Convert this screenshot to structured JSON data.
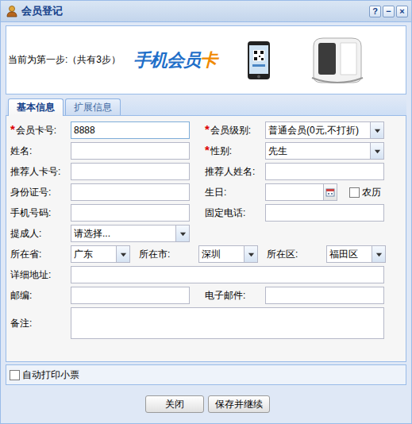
{
  "window": {
    "title": "会员登记",
    "controls": [
      "?",
      "−",
      "×"
    ]
  },
  "banner": {
    "step": "当前为第一步:（共有3步）",
    "logo": {
      "main": "手机会员",
      "accent": "卡"
    }
  },
  "tabs": [
    {
      "label": "基本信息",
      "selected": true
    },
    {
      "label": "扩展信息",
      "selected": false
    }
  ],
  "form": {
    "rows": [
      {
        "kind": "pair",
        "cells": [
          {
            "label": "会员卡号:",
            "required": true,
            "control": "text",
            "value": "8888",
            "focused": true
          },
          {
            "label": "会员级别:",
            "required": true,
            "control": "select",
            "value": "普通会员(0元,不打折)",
            "focused": false
          }
        ]
      },
      {
        "kind": "pair",
        "cells": [
          {
            "label": "姓名:",
            "required": false,
            "control": "text",
            "value": "",
            "focused": false
          },
          {
            "label": "性别:",
            "required": true,
            "control": "select",
            "value": "先生",
            "focused": false
          }
        ]
      },
      {
        "kind": "pair",
        "cells": [
          {
            "label": "推荐人卡号:",
            "required": false,
            "control": "text",
            "value": "",
            "focused": false
          },
          {
            "label": "推荐人姓名:",
            "required": false,
            "control": "text",
            "value": "",
            "focused": false
          }
        ]
      },
      {
        "kind": "pair",
        "cells": [
          {
            "label": "身份证号:",
            "required": false,
            "control": "text",
            "value": "",
            "focused": false
          },
          {
            "label": "生日:",
            "required": false,
            "control": "date",
            "value": "",
            "focused": false,
            "extra": {
              "label": "农历",
              "checked": false
            }
          }
        ]
      },
      {
        "kind": "pair",
        "cells": [
          {
            "label": "手机号码:",
            "required": false,
            "control": "text",
            "value": "",
            "focused": false
          },
          {
            "label": "固定电话:",
            "required": false,
            "control": "text",
            "value": "",
            "focused": false
          }
        ]
      },
      {
        "kind": "single",
        "cells": [
          {
            "label": "提成人:",
            "required": false,
            "control": "select",
            "value": "请选择...",
            "focused": false
          }
        ]
      },
      {
        "kind": "triple",
        "cells": [
          {
            "label": "所在省:",
            "required": false,
            "control": "select",
            "value": "广东",
            "focused": false
          },
          {
            "label": "所在市:",
            "required": false,
            "control": "select",
            "value": "深圳",
            "focused": false
          },
          {
            "label": "所在区:",
            "required": false,
            "control": "select",
            "value": "福田区",
            "focused": false
          }
        ]
      },
      {
        "kind": "wide",
        "cells": [
          {
            "label": "详细地址:",
            "required": false,
            "control": "text",
            "value": "",
            "focused": false
          }
        ]
      },
      {
        "kind": "pair",
        "cells": [
          {
            "label": "邮编:",
            "required": false,
            "control": "text",
            "value": "",
            "focused": false
          },
          {
            "label": "电子邮件:",
            "required": false,
            "control": "text",
            "value": "",
            "focused": false
          }
        ]
      },
      {
        "kind": "wide",
        "cells": [
          {
            "label": "备注:",
            "required": false,
            "control": "textarea",
            "value": "",
            "focused": false
          }
        ]
      }
    ]
  },
  "footer": {
    "print": {
      "label": "自动打印小票",
      "checked": false
    },
    "buttons": [
      "关闭",
      "保存并继续"
    ]
  }
}
